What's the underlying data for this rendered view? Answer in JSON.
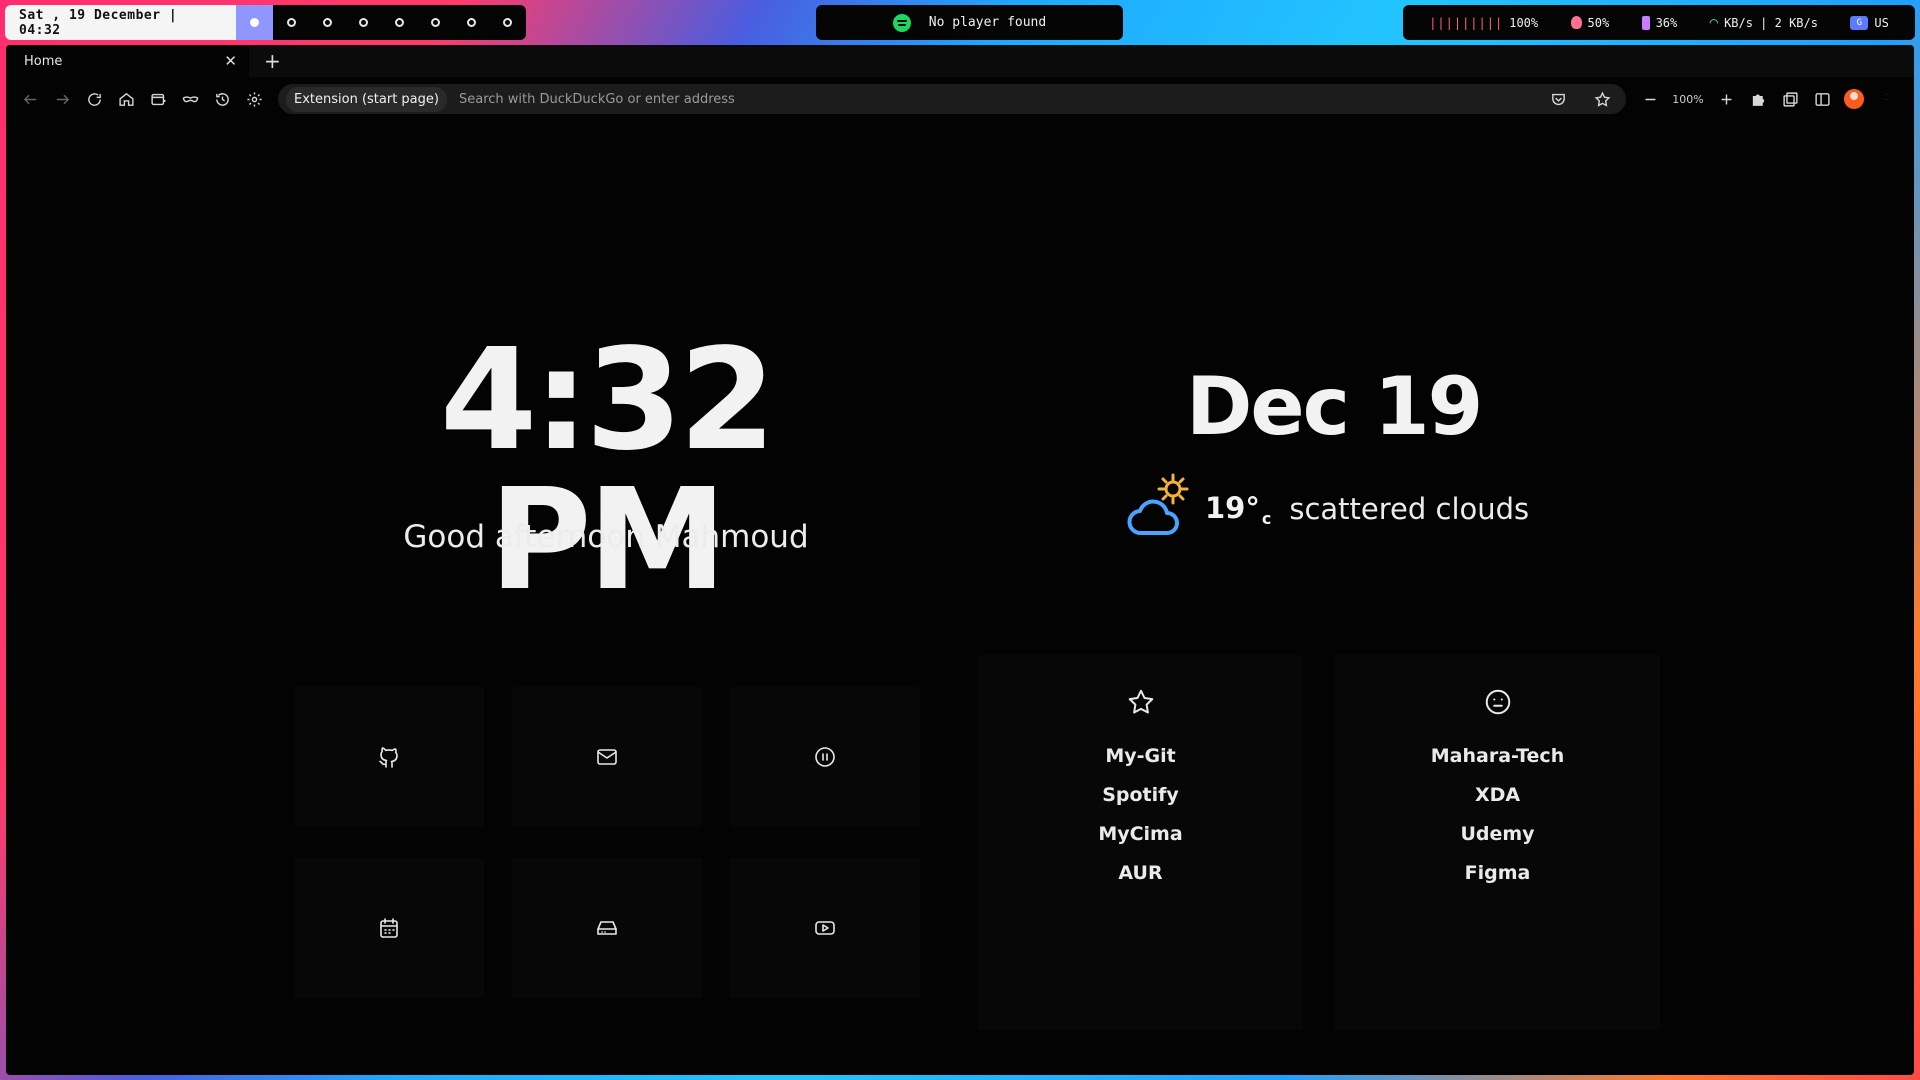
{
  "topbar": {
    "clock": "Sat , 19 December | 04:32",
    "workspaces": [
      "1",
      "2",
      "3",
      "4",
      "5",
      "6",
      "7",
      "8"
    ],
    "player": "No player found",
    "volume_bars": "|||||||||",
    "volume": "100%",
    "brightness": "50%",
    "battery": "36%",
    "network": "KB/s | 2 KB/s",
    "language": "US"
  },
  "browser": {
    "tab_title": "Home",
    "extension_label": "Extension (start page)",
    "url_placeholder": "Search with DuckDuckGo or enter address",
    "zoom": "100%"
  },
  "startpage": {
    "time": "4:32 PM",
    "greeting": "Good afternoon Mahmoud",
    "date": "Dec 19",
    "temperature": "19°",
    "temperature_unit": "c",
    "weather_description": "scattered clouds",
    "icon_tiles": [
      "github-icon",
      "mail-icon",
      "pause-icon",
      "calendar-icon",
      "drive-icon",
      "youtube-icon"
    ],
    "link_cards": [
      {
        "icon": "star-icon",
        "links": [
          "My-Git",
          "Spotify",
          "MyCima",
          "AUR"
        ]
      },
      {
        "icon": "neutral-face-icon",
        "links": [
          "Mahara-Tech",
          "XDA",
          "Udemy",
          "Figma"
        ]
      }
    ]
  },
  "colors": {
    "accent_workspace": "#8f97ff",
    "spotify": "#1ed760",
    "volume": "#ff5f87",
    "battery": "#c77dff",
    "wifi": "#3ee6a5",
    "weather_cloud": "#4aa3ff",
    "weather_sun": "#f4b23a"
  }
}
